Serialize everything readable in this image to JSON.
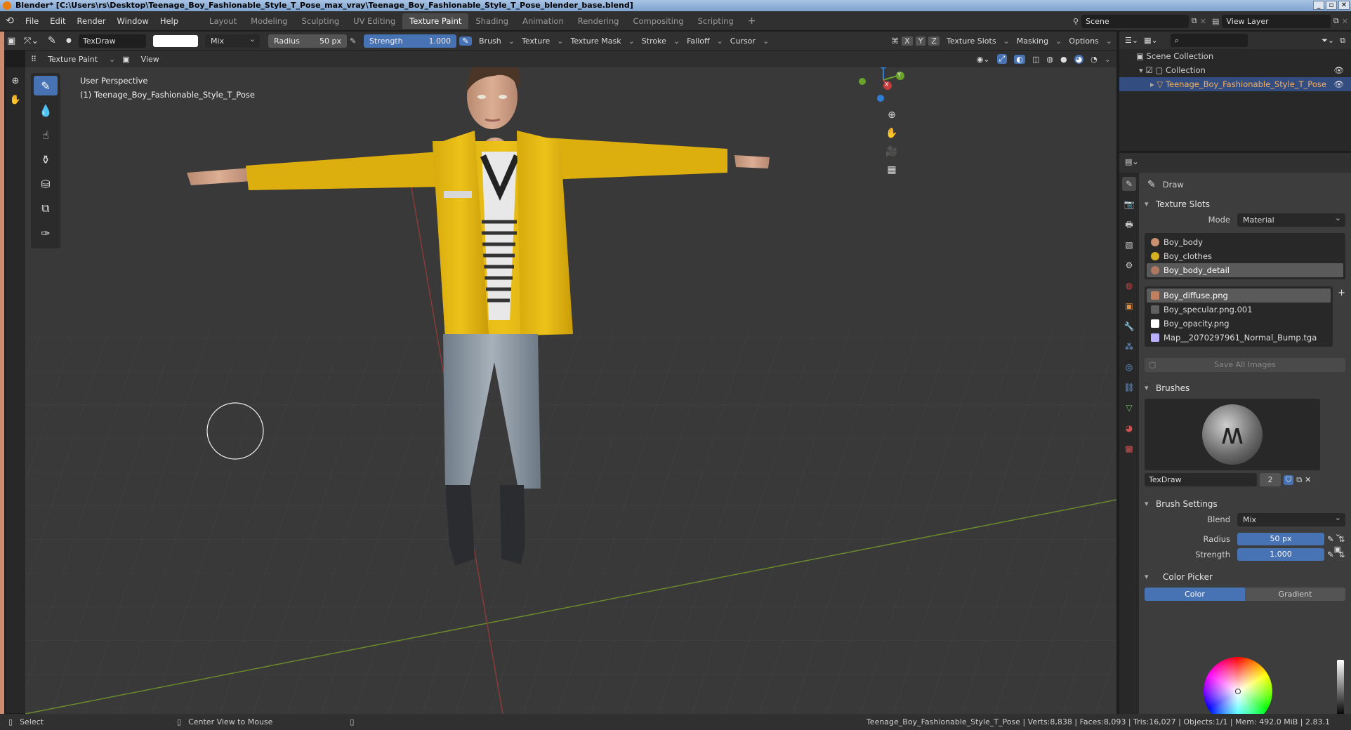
{
  "window": {
    "title": "Blender* [C:\\Users\\rs\\Desktop\\Teenage_Boy_Fashionable_Style_T_Pose_max_vray\\Teenage_Boy_Fashionable_Style_T_Pose_blender_base.blend]",
    "controls": [
      "_",
      "▫",
      "✕"
    ]
  },
  "menu": [
    "File",
    "Edit",
    "Render",
    "Window",
    "Help"
  ],
  "workspaces": [
    {
      "label": "Layout",
      "active": false
    },
    {
      "label": "Modeling",
      "active": false
    },
    {
      "label": "Sculpting",
      "active": false
    },
    {
      "label": "UV Editing",
      "active": false
    },
    {
      "label": "Texture Paint",
      "active": true
    },
    {
      "label": "Shading",
      "active": false
    },
    {
      "label": "Animation",
      "active": false
    },
    {
      "label": "Rendering",
      "active": false
    },
    {
      "label": "Compositing",
      "active": false
    },
    {
      "label": "Scripting",
      "active": false
    }
  ],
  "add_workspace": "+",
  "scene": {
    "label": "Scene"
  },
  "view_layer": {
    "label": "View Layer"
  },
  "tool_settings": {
    "brush_name": "TexDraw",
    "color_hex": "#ffffff",
    "blend": "Mix",
    "radius_label": "Radius",
    "radius_value": "50 px",
    "strength_label": "Strength",
    "strength_value": "1.000",
    "menus": [
      "Brush",
      "Texture",
      "Texture Mask",
      "Stroke",
      "Falloff",
      "Cursor"
    ],
    "axes": [
      "X",
      "Y",
      "Z"
    ],
    "right_menus": [
      "Texture Slots",
      "Masking",
      "Options"
    ]
  },
  "viewport_header": {
    "mode": "Texture Paint",
    "view_menu": "View"
  },
  "viewport_info": {
    "perspective": "User Perspective",
    "object": "(1) Teenage_Boy_Fashionable_Style_T_Pose"
  },
  "gizmo": {
    "z": "Z",
    "y": "Y",
    "x": "X"
  },
  "outliner": {
    "scene_collection": "Scene Collection",
    "collection": "Collection",
    "object": "Teenage_Boy_Fashionable_Style_T_Pose"
  },
  "properties": {
    "tool_name": "Draw",
    "texture_slots": {
      "title": "Texture Slots",
      "mode_label": "Mode",
      "mode_value": "Material",
      "materials": [
        {
          "name": "Boy_body",
          "selected": false,
          "color": "#c89070"
        },
        {
          "name": "Boy_clothes",
          "selected": false,
          "color": "#d4b020"
        },
        {
          "name": "Boy_body_detail",
          "selected": true,
          "color": "#b07860"
        }
      ],
      "images": [
        {
          "name": "Boy_diffuse.png",
          "selected": true,
          "color": "#c08060"
        },
        {
          "name": "Boy_specular.png.001",
          "selected": false,
          "color": "#606060"
        },
        {
          "name": "Boy_opacity.png",
          "selected": false,
          "color": "#ffffff"
        },
        {
          "name": "Map__2070297961_Normal_Bump.tga",
          "selected": false,
          "color": "#b8b0ff"
        }
      ],
      "save_all": "Save All Images"
    },
    "brushes": {
      "title": "Brushes",
      "name": "TexDraw",
      "users": "2"
    },
    "brush_settings": {
      "title": "Brush Settings",
      "blend_label": "Blend",
      "blend_value": "Mix",
      "radius_label": "Radius",
      "radius_value": "50 px",
      "strength_label": "Strength",
      "strength_value": "1.000"
    },
    "color_picker": {
      "title": "Color Picker",
      "tabs": [
        {
          "label": "Color",
          "active": true
        },
        {
          "label": "Gradient",
          "active": false
        }
      ]
    }
  },
  "status": {
    "select": "Select",
    "center": "Center View to Mouse",
    "stats": "Teenage_Boy_Fashionable_Style_T_Pose | Verts:8,838 | Faces:8,093 | Tris:16,027 | Objects:1/1 | Mem: 492.0 MiB | 2.83.1"
  },
  "colors": {
    "accent": "#4772b3",
    "jacket": "#e0b410",
    "jeans": "#8e9aa4",
    "boots": "#2b2d30",
    "skin": "#cd9e84"
  }
}
